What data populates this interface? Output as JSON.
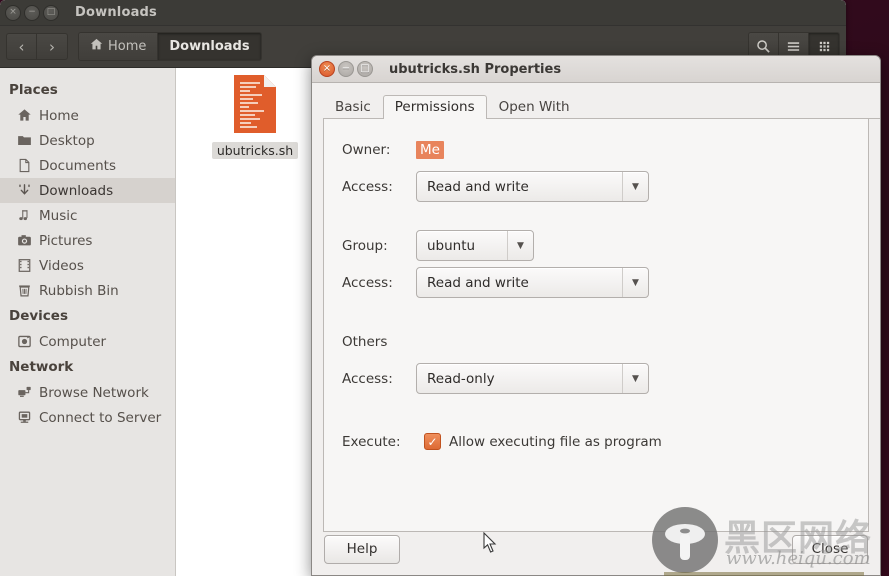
{
  "window": {
    "title": "Downloads",
    "controls": [
      {
        "name": "close",
        "glyph": "×"
      },
      {
        "name": "minimize",
        "glyph": "−"
      },
      {
        "name": "maximize",
        "glyph": "□"
      }
    ],
    "toolbar": {
      "back_label": "‹",
      "forward_label": "›",
      "breadcrumbs": [
        {
          "label": "Home",
          "icon": "home-icon",
          "active": false
        },
        {
          "label": "Downloads",
          "icon": "",
          "active": true
        }
      ],
      "actions": [
        {
          "name": "search-icon",
          "label": "Search"
        },
        {
          "name": "menu-icon",
          "label": "Menu"
        },
        {
          "name": "view-grid-icon",
          "label": "View options"
        }
      ]
    }
  },
  "sidebar": {
    "sections": [
      {
        "heading": "Places",
        "items": [
          {
            "label": "Home",
            "icon": "home-icon",
            "selected": false
          },
          {
            "label": "Desktop",
            "icon": "folder-icon",
            "selected": false
          },
          {
            "label": "Documents",
            "icon": "document-icon",
            "selected": false
          },
          {
            "label": "Downloads",
            "icon": "download-icon",
            "selected": true
          },
          {
            "label": "Music",
            "icon": "music-icon",
            "selected": false
          },
          {
            "label": "Pictures",
            "icon": "camera-icon",
            "selected": false
          },
          {
            "label": "Videos",
            "icon": "film-icon",
            "selected": false
          },
          {
            "label": "Rubbish Bin",
            "icon": "trash-icon",
            "selected": false
          }
        ]
      },
      {
        "heading": "Devices",
        "items": [
          {
            "label": "Computer",
            "icon": "computer-icon",
            "selected": false
          }
        ]
      },
      {
        "heading": "Network",
        "items": [
          {
            "label": "Browse Network",
            "icon": "network-icon",
            "selected": false
          },
          {
            "label": "Connect to Server",
            "icon": "server-icon",
            "selected": false
          }
        ]
      }
    ]
  },
  "files": [
    {
      "name": "ubutricks.sh",
      "icon": "script-file-icon",
      "selected": true
    }
  ],
  "dialog": {
    "title": "ubutricks.sh Properties",
    "controls": [
      {
        "name": "close",
        "glyph": "×"
      },
      {
        "name": "minimize",
        "glyph": "−"
      },
      {
        "name": "maximize",
        "glyph": "□"
      }
    ],
    "tabs": [
      {
        "label": "Basic",
        "active": false
      },
      {
        "label": "Permissions",
        "active": true
      },
      {
        "label": "Open With",
        "active": false
      }
    ],
    "permissions": {
      "owner_label": "Owner:",
      "owner_value": "Me",
      "owner_access_label": "Access:",
      "owner_access_value": "Read and write",
      "group_label": "Group:",
      "group_value": "ubuntu",
      "group_access_label": "Access:",
      "group_access_value": "Read and write",
      "others_label": "Others",
      "others_access_label": "Access:",
      "others_access_value": "Read-only",
      "execute_label": "Execute:",
      "execute_checkbox_label": "Allow executing file as program",
      "execute_checked": true,
      "check_glyph": "✓"
    },
    "footer": {
      "help_label": "Help",
      "close_label": "Close"
    }
  },
  "watermark": {
    "text_cn": "黑区网络",
    "url": "www.heiqu.com"
  },
  "colors": {
    "accent_orange": "#dd6a34",
    "selection_orange": "#e8845c",
    "titlebar_dark": "#3c3b37",
    "sidebar_bg": "#e7e5e3",
    "dialog_bg": "#f1efee"
  }
}
